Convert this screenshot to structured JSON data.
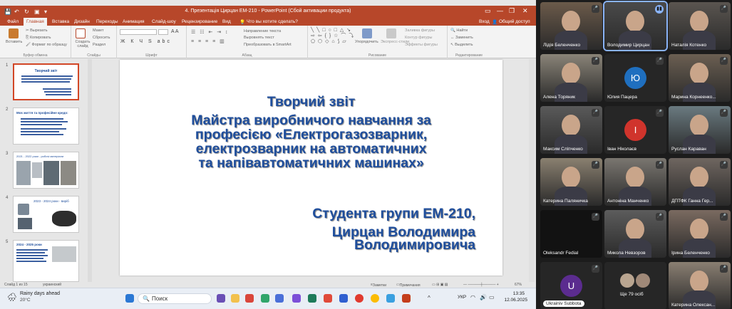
{
  "powerpoint": {
    "title": "4. Презентація Цирцан ЕМ-210 - PowerPoint (Сбой активации продукта)",
    "signin": "Вход",
    "share": "Общий доступ",
    "tabs": [
      "Файл",
      "Главная",
      "Вставка",
      "Дизайн",
      "Переходы",
      "Анимация",
      "Слайд-шоу",
      "Рецензирование",
      "Вид"
    ],
    "tell_me": "Что вы хотите сделать?",
    "ribbon": {
      "paste": "Вставить",
      "cut": "Вырезать",
      "copy": "Копировать",
      "format_painter": "Формат по образцу",
      "clipboard_group": "Буфер обмена",
      "new_slide": "Создать слайд",
      "layout": "Макет",
      "reset": "Сбросить",
      "section": "Раздел",
      "slides_group": "Слайды",
      "font_group": "Шрифт",
      "text_direction": "Направление текста",
      "align_text": "Выровнять текст",
      "smartart": "Преобразовать в SmartArt",
      "paragraph_group": "Абзац",
      "arrange": "Упорядочить",
      "quick_styles": "Экспресс-стили",
      "shape_fill": "Заливка фигуры",
      "shape_outline": "Контур фигуры",
      "shape_effects": "Эффекты фигуры",
      "drawing_group": "Рисование",
      "find": "Найти",
      "replace": "Заменить",
      "select": "Выделить",
      "editing_group": "Редактирование"
    },
    "thumbnails": [
      {
        "num": "1",
        "text": "Творчий звіт"
      },
      {
        "num": "2",
        "text": "Моє життя та професійне кредо:"
      },
      {
        "num": "3",
        "text": "2021 - 2022 роки - робочі матеріали"
      },
      {
        "num": "4",
        "text": "2023 - 2024 роки - виріб"
      },
      {
        "num": "5",
        "text": "2024 - 2025 роки"
      }
    ],
    "slide": {
      "title_lines": [
        "Творчий звіт",
        "Майстра виробничого навчання за",
        "професією «Електрогазозварник,",
        "електрозварник на автоматичних",
        "та напівавтоматичних машинах»"
      ],
      "author_lines": [
        "Студента групи ЕМ-210,",
        "Цирцан Володимира",
        "Володимировича"
      ]
    },
    "status": {
      "slide": "Слайд 1 из 15",
      "language": "украинский",
      "notes": "Заметки",
      "comments": "Примечания",
      "zoom": "67%"
    }
  },
  "taskbar": {
    "weather_title": "Rainy days ahead",
    "weather_temp": "20°C",
    "search": "Поиск",
    "language": "УКР",
    "time": "13:35",
    "date": "12.06.2025"
  },
  "participants": [
    {
      "name": "Лідія Беленченко",
      "muted": true,
      "kind": "photo",
      "color": "#6b5a4a"
    },
    {
      "name": "Володимир Цирцан",
      "muted": false,
      "kind": "photo",
      "color": "#4a4a4a",
      "speaking": true
    },
    {
      "name": "Наталія Котенко",
      "muted": true,
      "kind": "photo",
      "color": "#5a5550"
    },
    {
      "name": "Алена Торяник",
      "muted": true,
      "kind": "photo",
      "color": "#8a8478"
    },
    {
      "name": "Юлия Пацера",
      "muted": true,
      "kind": "avatar",
      "initial": "Ю",
      "color": "#1f6fbf"
    },
    {
      "name": "Марина Корнеенко...",
      "muted": true,
      "kind": "photo",
      "color": "#6b5f52"
    },
    {
      "name": "Максим Сліпченко",
      "muted": true,
      "kind": "photo",
      "color": "#5a5a5a"
    },
    {
      "name": "Іван Ніколаєв",
      "muted": true,
      "kind": "avatar",
      "initial": "І",
      "color": "#d0342c"
    },
    {
      "name": "Руслан Караван",
      "muted": true,
      "kind": "photo",
      "color": "#6a7a80"
    },
    {
      "name": "Катерина Паляничка",
      "muted": true,
      "kind": "photo",
      "color": "#8a8070"
    },
    {
      "name": "Антоніна Манченко",
      "muted": true,
      "kind": "photo",
      "color": "#7a7670"
    },
    {
      "name": "ДПТФК Ганна Гер...",
      "muted": true,
      "kind": "photo",
      "color": "#6f6660"
    },
    {
      "name": "Oleksandr Fedial",
      "muted": true,
      "kind": "dark",
      "color": "#121212"
    },
    {
      "name": "Микола Невзоров",
      "muted": true,
      "kind": "photo",
      "color": "#5c5c5c"
    },
    {
      "name": "Ірина Беленченко",
      "muted": true,
      "kind": "photo",
      "color": "#7a6a60"
    },
    {
      "name": "Ukrainiv Subbota",
      "muted": true,
      "kind": "avatar",
      "initial": "U",
      "color": "#5b2c8f"
    },
    {
      "name": "Ще 79 осіб",
      "muted": false,
      "kind": "more",
      "color": "#3a3a3a"
    },
    {
      "name": "Катерина Олексан...",
      "muted": true,
      "kind": "photo",
      "color": "#8a7f72"
    }
  ]
}
